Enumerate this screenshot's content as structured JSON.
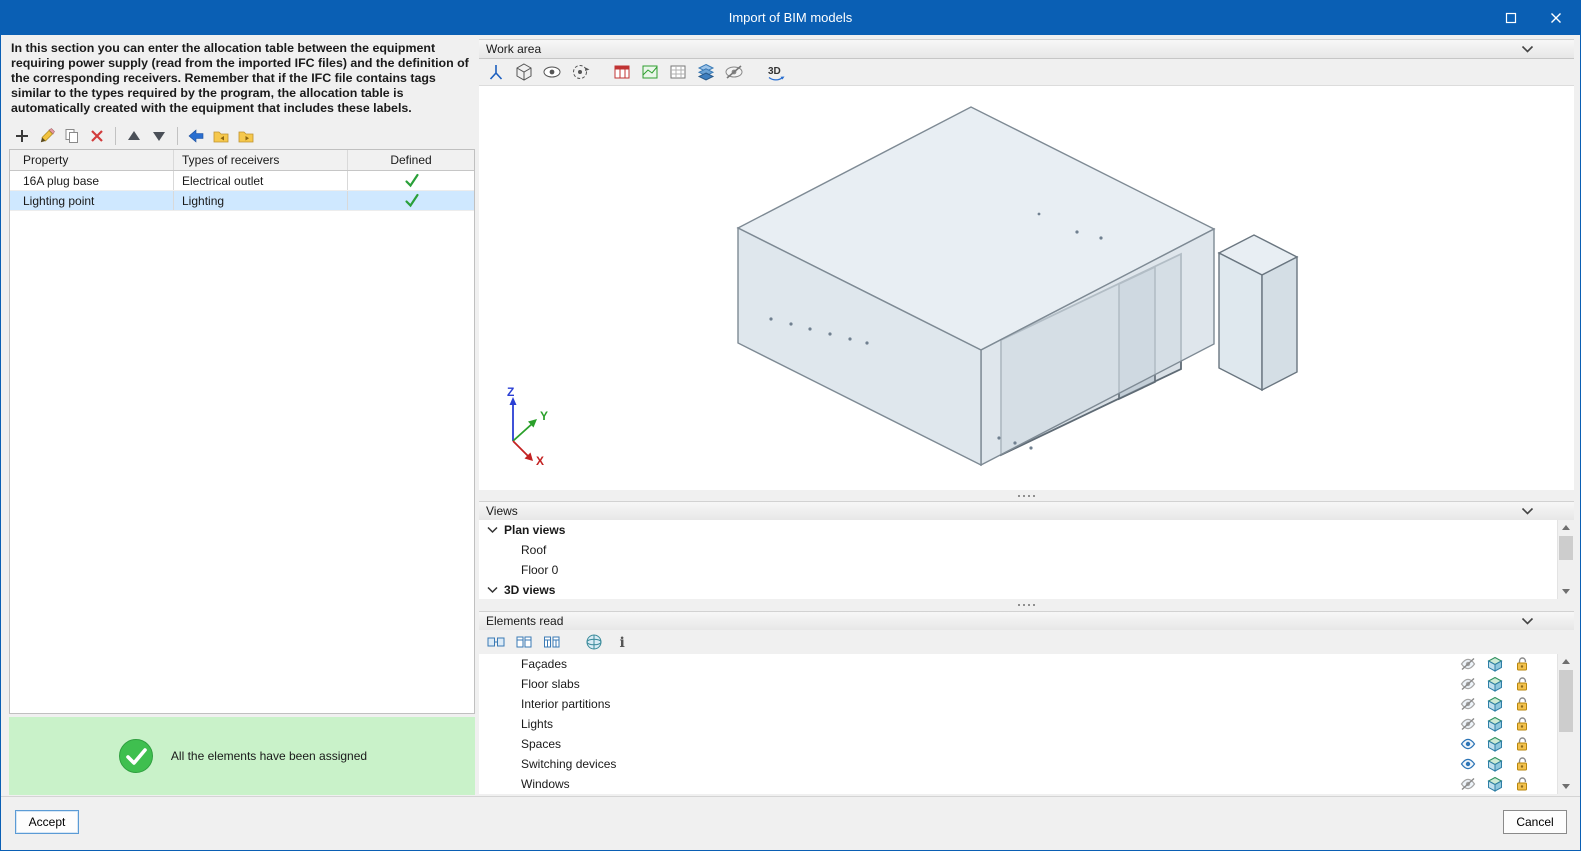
{
  "window": {
    "title": "Import of BIM models"
  },
  "left_panel": {
    "description": "In this section you can enter the allocation table between the equipment requiring power supply (read from the imported IFC files) and the definition of the corresponding receivers. Remember that if the IFC file contains tags similar to the types required by the program, the allocation table is automatically created with the equipment that includes these labels.",
    "table": {
      "headers": {
        "property": "Property",
        "types": "Types of receivers",
        "defined": "Defined"
      },
      "rows": [
        {
          "property": "16A plug base",
          "types": "Electrical outlet",
          "defined": true,
          "selected": false
        },
        {
          "property": "Lighting point",
          "types": "Lighting",
          "defined": true,
          "selected": true
        }
      ]
    },
    "status_message": "All the elements have been assigned"
  },
  "work_area": {
    "title": "Work area",
    "toolbar_3d_label": "3D"
  },
  "axis_gizmo": {
    "x": "X",
    "y": "Y",
    "z": "Z"
  },
  "views": {
    "title": "Views",
    "groups": [
      {
        "label": "Plan views",
        "items": [
          "Roof",
          "Floor 0"
        ]
      },
      {
        "label": "3D views",
        "items": []
      }
    ]
  },
  "elements_read": {
    "title": "Elements read",
    "rows": [
      {
        "label": "Façades",
        "visible": false
      },
      {
        "label": "Floor slabs",
        "visible": false
      },
      {
        "label": "Interior partitions",
        "visible": false
      },
      {
        "label": "Lights",
        "visible": false
      },
      {
        "label": "Spaces",
        "visible": true
      },
      {
        "label": "Switching devices",
        "visible": true
      },
      {
        "label": "Windows",
        "visible": false
      }
    ]
  },
  "footer": {
    "accept_label": "Accept",
    "cancel_label": "Cancel"
  },
  "colors": {
    "title_bar": "#0a5fb4",
    "selection": "#cfe8ff",
    "success_bg": "#c9f2c9",
    "success_green": "#3fbf4f"
  }
}
